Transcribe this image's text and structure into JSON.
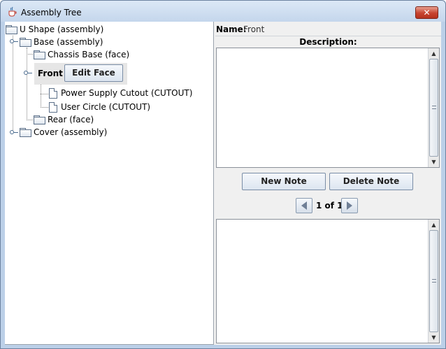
{
  "window": {
    "title": "Assembly Tree",
    "close_symbol": "✕"
  },
  "tree": {
    "root": "U Shape (assembly)",
    "base": "Base (assembly)",
    "chassis": "Chassis Base (face)",
    "front": "Front",
    "edit_face_button": "Edit Face",
    "cutout1": "Power Supply Cutout (CUTOUT)",
    "cutout2": "User Circle (CUTOUT)",
    "rear": "Rear (face)",
    "cover": "Cover (assembly)"
  },
  "details": {
    "name_label": "Name:",
    "name_value": "Front",
    "description_label": "Description:",
    "description_text": "",
    "note_text": ""
  },
  "notes": {
    "new_note": "New Note",
    "delete_note": "Delete Note",
    "page_indicator": "1 of 1"
  },
  "icons": {
    "java": "java-cup-icon",
    "folder": "folder-icon",
    "file": "file-icon",
    "prev": "left-arrow-icon",
    "next": "right-arrow-icon"
  },
  "colors": {
    "close_button": "#c7432f",
    "nav_arrow": "#6f7f96",
    "titlebar": "#c4d6ec"
  }
}
